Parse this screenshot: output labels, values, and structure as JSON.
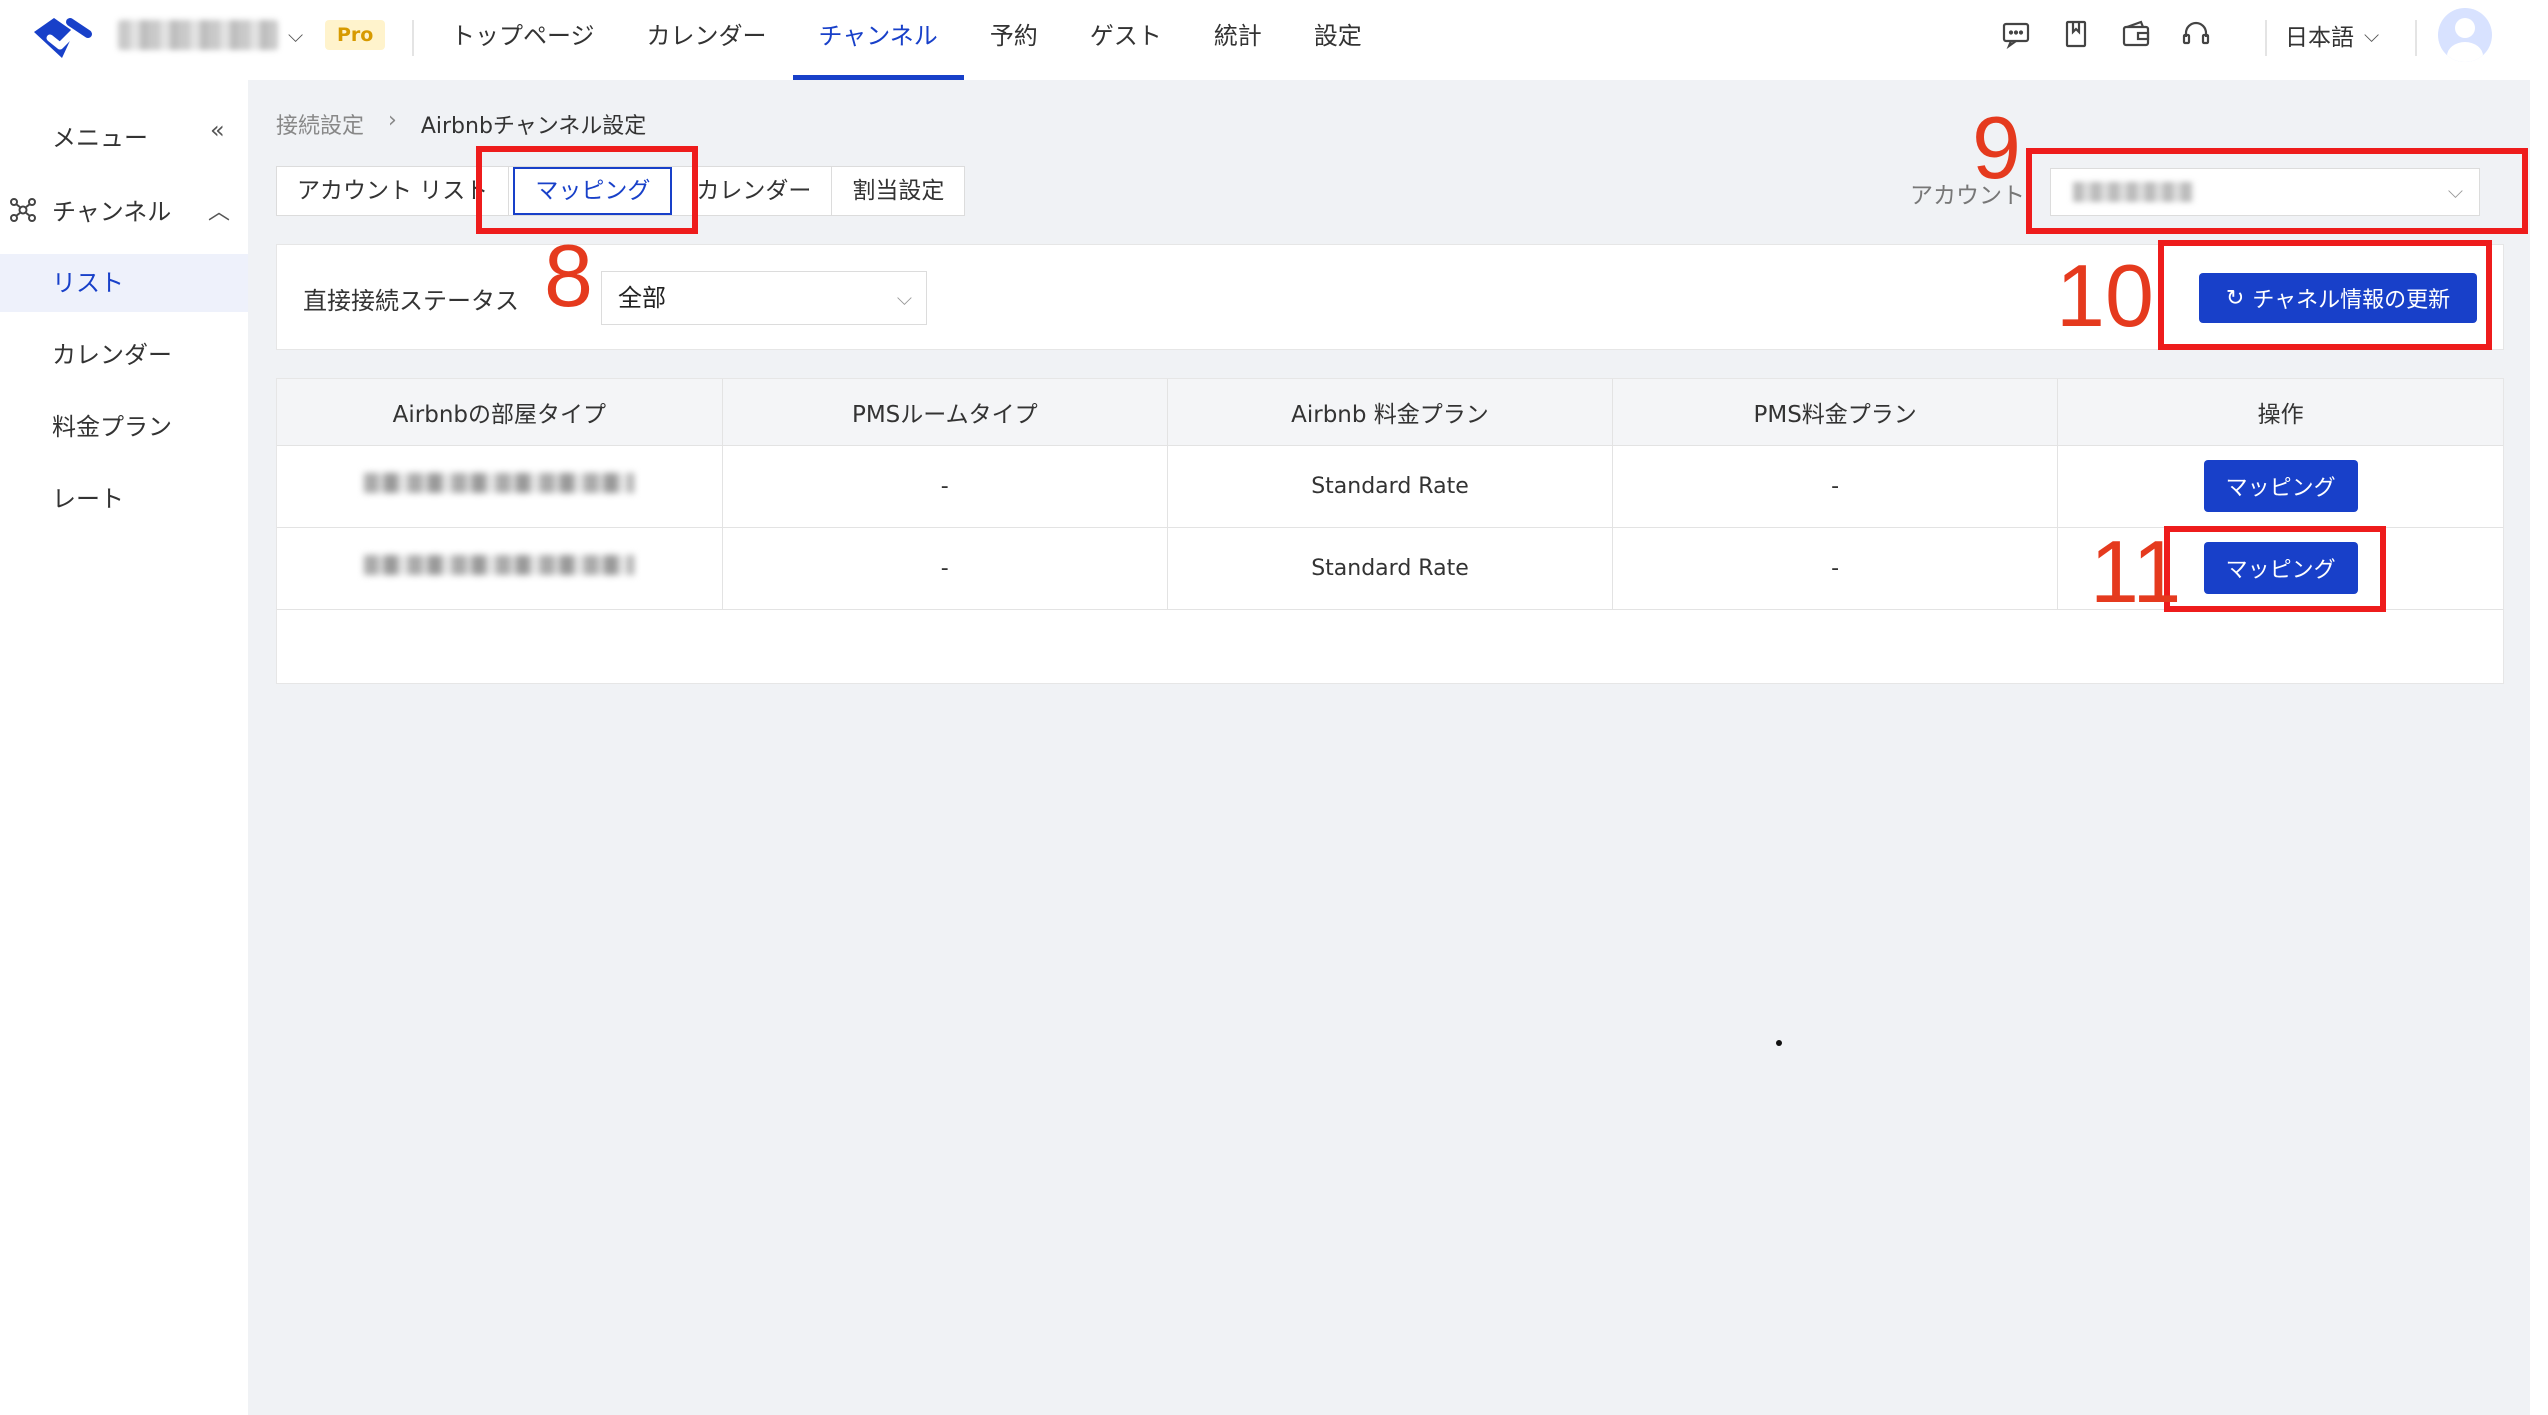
{
  "header": {
    "org_badge": "Pro",
    "nav": [
      "トップページ",
      "カレンダー",
      "チャンネル",
      "予約",
      "ゲスト",
      "統計",
      "設定"
    ],
    "nav_active_index": 2,
    "language": "日本語",
    "icons": [
      "message-icon",
      "bookmark-icon",
      "wallet-icon",
      "headset-icon"
    ]
  },
  "sidebar": {
    "menu_label": "メニュー",
    "collapse_icon": "«",
    "group_label": "チャンネル",
    "items": [
      "リスト",
      "カレンダー",
      "料金プラン",
      "レート"
    ],
    "active_index": 0
  },
  "breadcrumb": {
    "parent": "接続設定",
    "current": "Airbnbチャンネル設定"
  },
  "tabs": [
    "アカウント リスト",
    "マッピング",
    "カレンダー",
    "割当設定"
  ],
  "tabs_active_index": 1,
  "account": {
    "label": "アカウント"
  },
  "filter": {
    "label": "直接接続ステータス",
    "value": "全部"
  },
  "refresh_button": "チャネル情報の更新",
  "table": {
    "columns": [
      "Airbnbの部屋タイプ",
      "PMSルームタイプ",
      "Airbnb 料金プラン",
      "PMS料金プラン",
      "操作"
    ],
    "rows": [
      {
        "pms_room": "-",
        "airbnb_plan": "Standard Rate",
        "pms_plan": "-",
        "action": "マッピング"
      },
      {
        "pms_room": "-",
        "airbnb_plan": "Standard Rate",
        "pms_plan": "-",
        "action": "マッピング"
      }
    ]
  },
  "annotations": [
    "8",
    "9",
    "10",
    "11"
  ],
  "colors": {
    "primary": "#1840c9",
    "annotation": "#ee1c1c",
    "pro_badge": "#d79a00"
  }
}
